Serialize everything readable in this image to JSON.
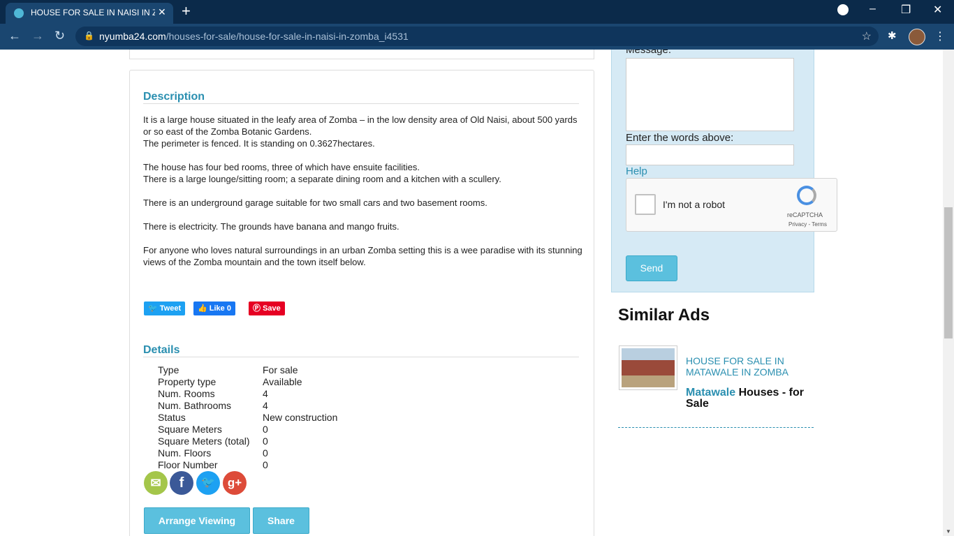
{
  "browser": {
    "tab_title": "HOUSE FOR SALE IN NAISI IN ZOMBA",
    "tab_close": "✕",
    "new_tab": "+",
    "url_domain": "nyumba24.com",
    "url_path": "/houses-for-sale/house-for-sale-in-naisi-in-zomba_i4531"
  },
  "description": {
    "heading": "Description",
    "lines": [
      "It is a large house situated in the leafy area of Zomba – in the low density area of Old Naisi, about 500 yards or so east of the Zomba Botanic Gardens.",
      "The perimeter is fenced. It is standing on 0.3627hectares.",
      "The house has four bed rooms, three of which have ensuite facilities.",
      "There is a large lounge/sitting room; a separate dining room and a kitchen with a scullery.",
      "There is an underground garage suitable for two small cars and two basement rooms.",
      "There is electricity. The grounds have banana and mango fruits.",
      "For anyone who loves natural surroundings in an urban Zomba setting this is a wee paradise with its stunning views of the Zomba mountain and the town itself below."
    ]
  },
  "share_buttons": {
    "tweet": "Tweet",
    "like": "Like 0",
    "save": "Save"
  },
  "details": {
    "heading": "Details",
    "rows": [
      {
        "key": "Type",
        "value": "For sale"
      },
      {
        "key": "Property type",
        "value": "Available"
      },
      {
        "key": "Num. Rooms",
        "value": "4"
      },
      {
        "key": "Num. Bathrooms",
        "value": "4"
      },
      {
        "key": "Status",
        "value": "New construction"
      },
      {
        "key": "Square Meters",
        "value": "0"
      },
      {
        "key": "Square Meters (total)",
        "value": "0"
      },
      {
        "key": "Num. Floors",
        "value": "0"
      },
      {
        "key": "Floor Number",
        "value": "0"
      }
    ]
  },
  "actions": {
    "arrange_viewing": "Arrange Viewing",
    "share": "Share"
  },
  "contact_form": {
    "message_label": "Message:",
    "words_label": "Enter the words above:",
    "help": "Help",
    "captcha_text": "I'm not a robot",
    "captcha_brand": "reCAPTCHA",
    "captcha_terms": "Privacy - Terms",
    "send": "Send"
  },
  "similar": {
    "heading": "Similar Ads",
    "item_title": "HOUSE FOR SALE IN MATAWALE IN ZOMBA",
    "item_location": "Matawale",
    "item_category": "Houses - for Sale"
  },
  "colors": {
    "accent": "#2a8fb0",
    "button": "#5bc0de",
    "sidebar_bg": "#d6eaf5"
  }
}
